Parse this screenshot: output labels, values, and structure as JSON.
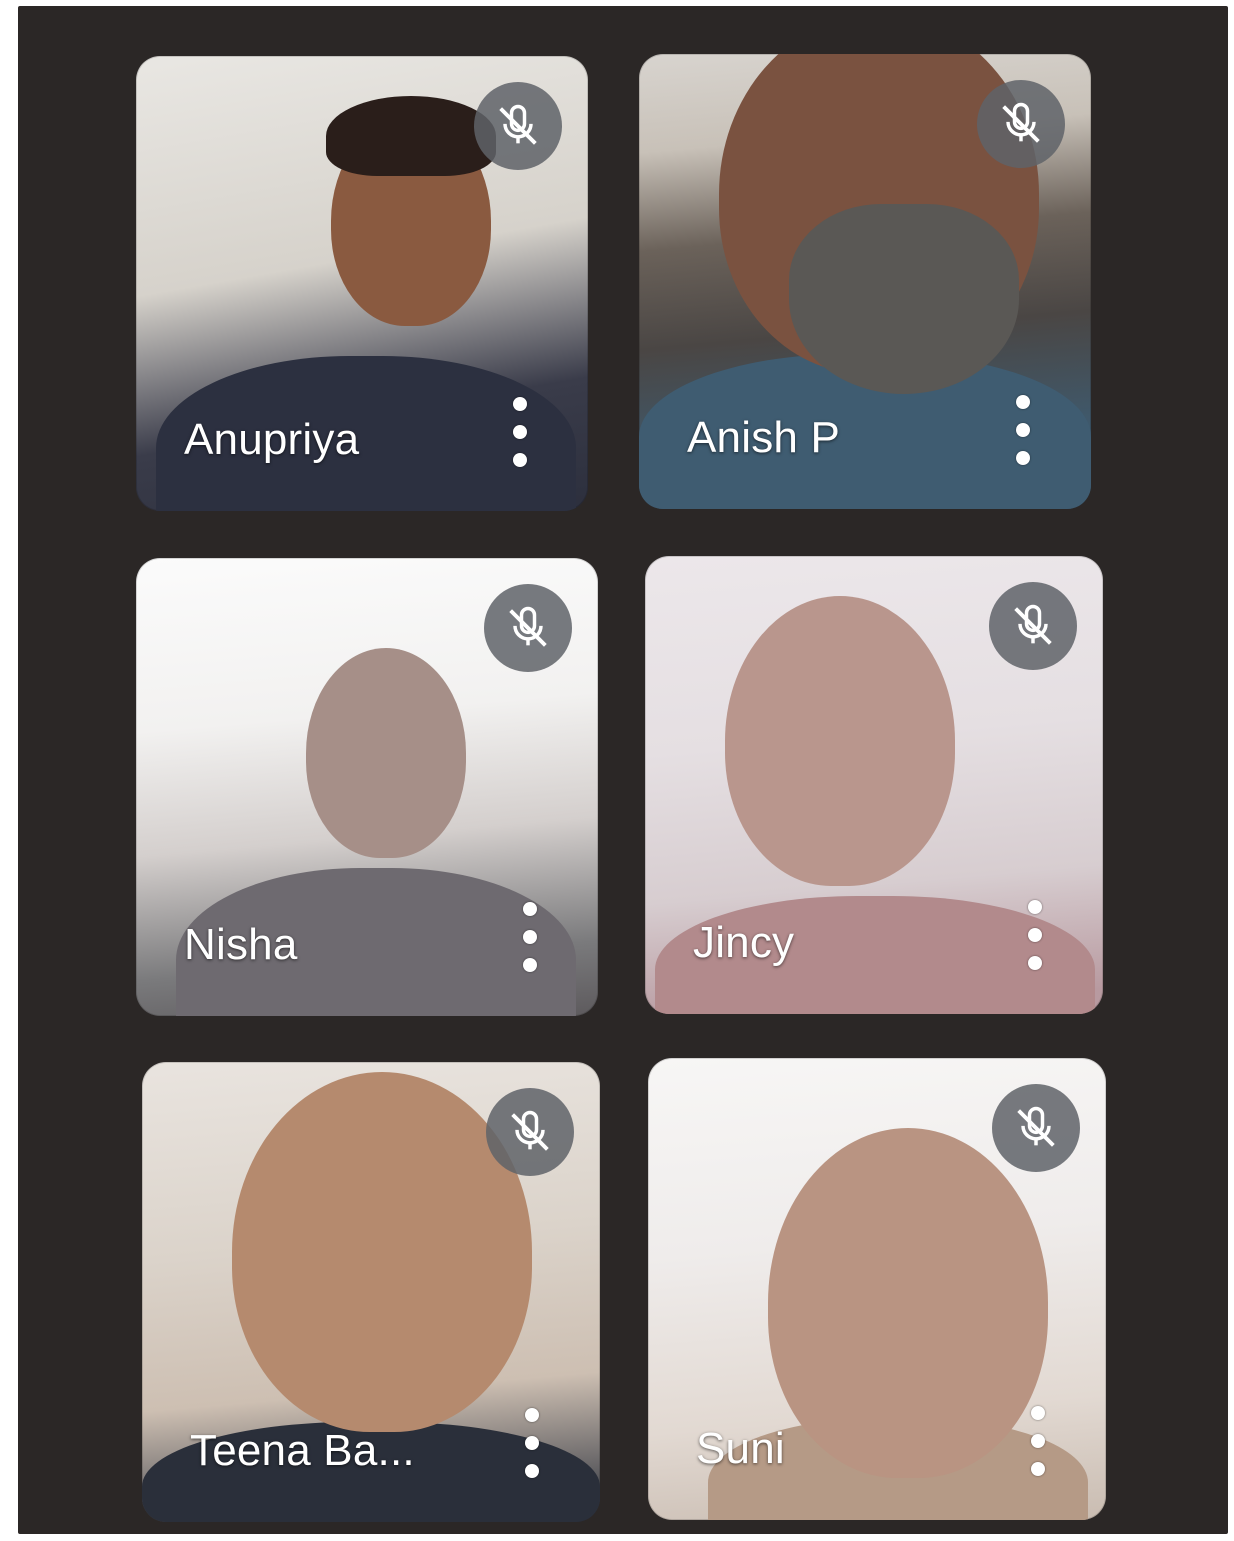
{
  "participants": [
    {
      "name": "Anupriya",
      "muted": true
    },
    {
      "name": "Anish P",
      "muted": true
    },
    {
      "name": "Nisha",
      "muted": true
    },
    {
      "name": "Jincy",
      "muted": true
    },
    {
      "name": "Teena Ba...",
      "muted": true
    },
    {
      "name": "Suni",
      "muted": true
    }
  ],
  "icons": {
    "muted": "mic-off-icon",
    "more": "more-vert-icon"
  },
  "colors": {
    "background": "#2b2726",
    "badge": "#5f6368",
    "label": "#ffffff"
  }
}
